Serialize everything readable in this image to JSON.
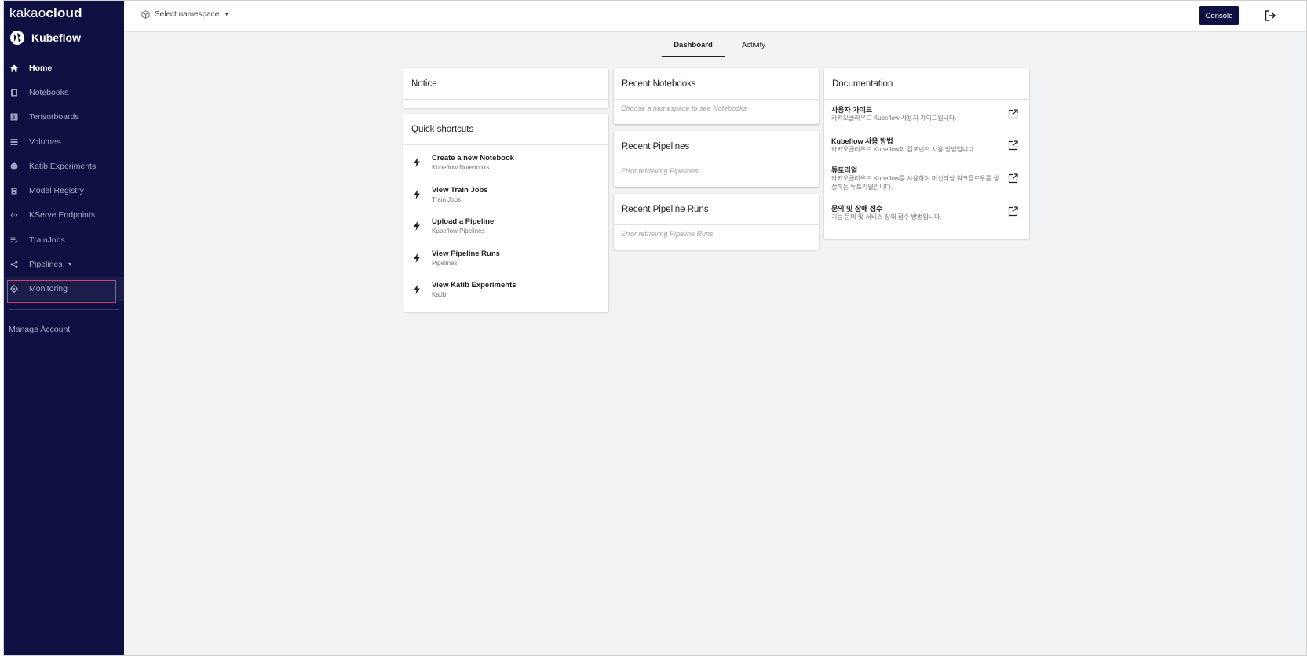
{
  "brand": {
    "name_light": "kakao",
    "name_bold": "cloud"
  },
  "product": {
    "name": "Kubeflow"
  },
  "sidebar": {
    "items": [
      {
        "label": "Home",
        "icon": "home-icon"
      },
      {
        "label": "Notebooks",
        "icon": "book-icon"
      },
      {
        "label": "Tensorboards",
        "icon": "chart-icon"
      },
      {
        "label": "Volumes",
        "icon": "storage-icon"
      },
      {
        "label": "Katib Experiments",
        "icon": "katib-icon"
      },
      {
        "label": "Model Registry",
        "icon": "clipboard-icon"
      },
      {
        "label": "KServe Endpoints",
        "icon": "code-arrows-icon"
      },
      {
        "label": "TrainJobs",
        "icon": "list-check-icon"
      },
      {
        "label": "Pipelines",
        "icon": "share-icon"
      },
      {
        "label": "Monitoring",
        "icon": "gear-monitor-icon"
      }
    ],
    "manage_account": "Manage Account"
  },
  "topbar": {
    "namespace_label": "Select namespace",
    "console_label": "Console"
  },
  "tabs": [
    "Dashboard",
    "Activity"
  ],
  "cards": {
    "notice": {
      "title": "Notice"
    },
    "quick_shortcuts": {
      "title": "Quick shortcuts",
      "items": [
        {
          "title": "Create a new Notebook",
          "sub": "Kubeflow Notebooks"
        },
        {
          "title": "View Train Jobs",
          "sub": "Train Jobs"
        },
        {
          "title": "Upload a Pipeline",
          "sub": "Kubeflow Pipelines"
        },
        {
          "title": "View Pipeline Runs",
          "sub": "Pipelines"
        },
        {
          "title": "View Katib Experiments",
          "sub": "Katib"
        }
      ]
    },
    "recent_notebooks": {
      "title": "Recent Notebooks",
      "empty": "Choose a namespace to see Notebooks"
    },
    "recent_pipelines": {
      "title": "Recent Pipelines",
      "empty": "Error retrieving Pipelines"
    },
    "recent_pipeline_runs": {
      "title": "Recent Pipeline Runs",
      "empty": "Error retrieving Pipeline Runs"
    },
    "documentation": {
      "title": "Documentation",
      "items": [
        {
          "title": "사용자 가이드",
          "sub": "카카오클라우드 Kubeflow 사용자 가이드입니다."
        },
        {
          "title": "Kubeflow 사용 방법",
          "sub": "카카오클라우드 Kubeflow의 컴포넌트 사용 방법입니다."
        },
        {
          "title": "튜토리얼",
          "sub": "카카오클라우드 Kubeflow를 사용하여 머신러닝 워크플로우를 생성하는 튜토리얼입니다."
        },
        {
          "title": "문의 및 장애 접수",
          "sub": "기능 문의 및 서비스 장애 접수 방법입니다."
        }
      ]
    }
  },
  "colors": {
    "sidebar_bg": "#0d1040",
    "highlight": "#d63f6f",
    "page_bg": "#f1f3f4"
  }
}
